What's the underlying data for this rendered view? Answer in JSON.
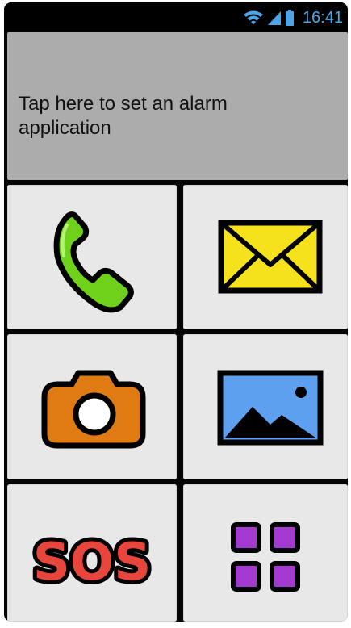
{
  "status_bar": {
    "time": "16:41",
    "icons": [
      "wifi-icon",
      "signal-icon",
      "battery-icon"
    ]
  },
  "banner": {
    "text": "Tap here to set an alarm application"
  },
  "tiles": [
    {
      "name": "phone",
      "icon": "phone-icon",
      "color": "#6fd11a"
    },
    {
      "name": "messages",
      "icon": "envelope-icon",
      "color": "#f5e21d"
    },
    {
      "name": "camera",
      "icon": "camera-icon",
      "color": "#e07a12"
    },
    {
      "name": "gallery",
      "icon": "picture-icon",
      "color": "#5ea0f0"
    },
    {
      "name": "sos",
      "icon": "sos-icon",
      "label": "SOS",
      "color": "#e8453c"
    },
    {
      "name": "apps",
      "icon": "apps-grid-icon",
      "color": "#a33bd0"
    }
  ]
}
